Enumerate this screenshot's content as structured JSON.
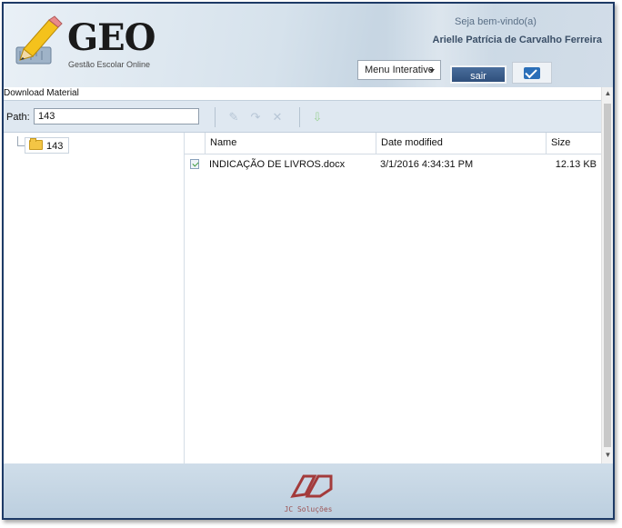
{
  "header": {
    "logo_title": "GEO",
    "logo_subtitle": "Gestão Escolar Online",
    "welcome_text": "Seja bem-vindo(a)",
    "user_name": "Arielle Patrícia de Carvalho Ferreira",
    "menu_select_value": "Menu Interativo",
    "logout_label": "sair",
    "mail_icon": "mail-icon"
  },
  "panel": {
    "title": "Download Material",
    "path_label": "Path:",
    "path_value": "143"
  },
  "toolbar_icons": [
    "edit-icon",
    "redo-icon",
    "delete-icon",
    "download-icon"
  ],
  "tree": {
    "root_label": "143",
    "root_icon": "folder-icon"
  },
  "grid": {
    "columns": [
      "Name",
      "Date modified",
      "Size"
    ],
    "rows": [
      {
        "name": "INDICAÇÃO DE LIVROS.docx",
        "date_modified": "3/1/2016 4:34:31 PM",
        "size": "12.13 KB",
        "icon": "document-icon"
      }
    ]
  },
  "footer": {
    "brand_text": "JC Soluções"
  },
  "colors": {
    "frame_border": "#1d3a66",
    "header_bg": "#d6e2ec",
    "toolbar_bg": "#dfe8f1",
    "logout_button": "#2f4f7c",
    "footer_bg": "#c5d6e4",
    "brand_red": "#a33b3b"
  }
}
